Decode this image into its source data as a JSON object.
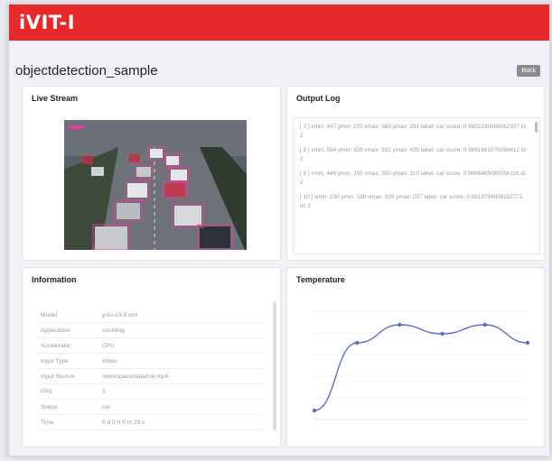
{
  "header": {
    "logo": "iVIT-I"
  },
  "page": {
    "title": "objectdetection_sample",
    "back_label": "Back"
  },
  "live": {
    "title": "Live Stream"
  },
  "log": {
    "title": "Output Log",
    "entries": [
      "[ 7 ] xmin: 447 ymin: 220 xmax: 563 ymax: 291 label: car score: 0.9902190566062927 id: 2",
      "[ 8 ] xmin: 584 ymin: 328 xmax: 832 ymax: 435 label: car score: 0.9891681075096612 id: 2",
      "[ 9 ] xmin: 449 ymin: 250 xmax: 550 ymax: 310 label: car score: 0.9868465065956116 id: 2",
      "[ 10 ] xmin: 230 ymin: 188 xmax: 326 ymax: 257 label: car score: 0.9819754958152771 id: 2"
    ]
  },
  "info": {
    "title": "Information",
    "rows": [
      {
        "key": "Model",
        "value": "yolo-v3-tf.xml"
      },
      {
        "key": "Application",
        "value": "counting"
      },
      {
        "key": "Accelerator",
        "value": "CPU"
      },
      {
        "key": "Input Type",
        "value": "Video"
      },
      {
        "key": "Input Source",
        "value": "/workspace/data/car.mp4"
      },
      {
        "key": "FPS",
        "value": "3"
      },
      {
        "key": "Status",
        "value": "run"
      },
      {
        "key": "Time",
        "value": "0 d 0 h 0 m 29 s"
      }
    ]
  },
  "temperature": {
    "title": "Temperature"
  },
  "chart_data": {
    "type": "line",
    "title": "Temperature",
    "x": [
      "",
      "",
      "",
      "",
      "",
      ""
    ],
    "series": [
      {
        "values": [
          40,
          55,
          59,
          57,
          59,
          55
        ],
        "color": "#5b6ccf"
      }
    ],
    "ylim": [
      38,
      62
    ],
    "yticks": [
      "",
      "",
      "",
      "",
      "",
      ""
    ],
    "grid": true
  },
  "colors": {
    "brand": "#e7292e",
    "line": "#5b6ccf"
  }
}
